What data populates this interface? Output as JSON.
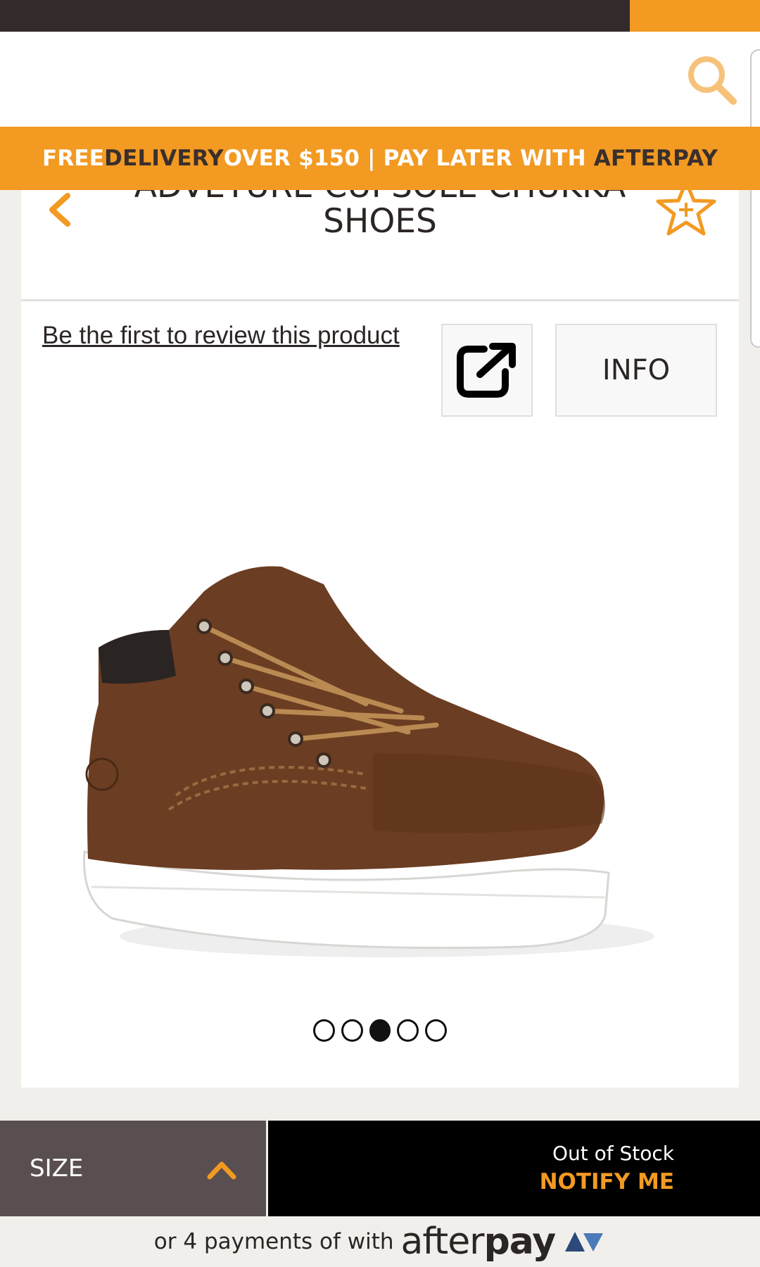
{
  "colors": {
    "brand_orange": "#f29a22",
    "top_bar": "#332b2b",
    "size_button": "#5a4f50",
    "notify_button": "#000000"
  },
  "promo": {
    "part1": "FREE ",
    "part2": "DELIVERY ",
    "part3": "OVER $150 | PAY LATER WITH ",
    "part4": "AFTERPAY"
  },
  "product": {
    "title_line1": "ADVETURE CUPSOLE CHUKKA",
    "title_line2": "SHOES",
    "review_link": "Be the first to review this product",
    "info_label": "INFO",
    "image_dots": {
      "count": 5,
      "active_index": 2
    }
  },
  "icons": {
    "search": "search-icon",
    "back": "chevron-left-icon",
    "favorite": "star-plus-icon",
    "share": "external-link-icon",
    "size_toggle": "chevron-up-icon"
  },
  "bottom_bar": {
    "size_label": "SIZE",
    "stock_status": "Out of Stock",
    "notify_label": "NOTIFY ME"
  },
  "afterpay": {
    "text": "or 4 payments of with",
    "logo_light": "after",
    "logo_bold": "pay"
  }
}
